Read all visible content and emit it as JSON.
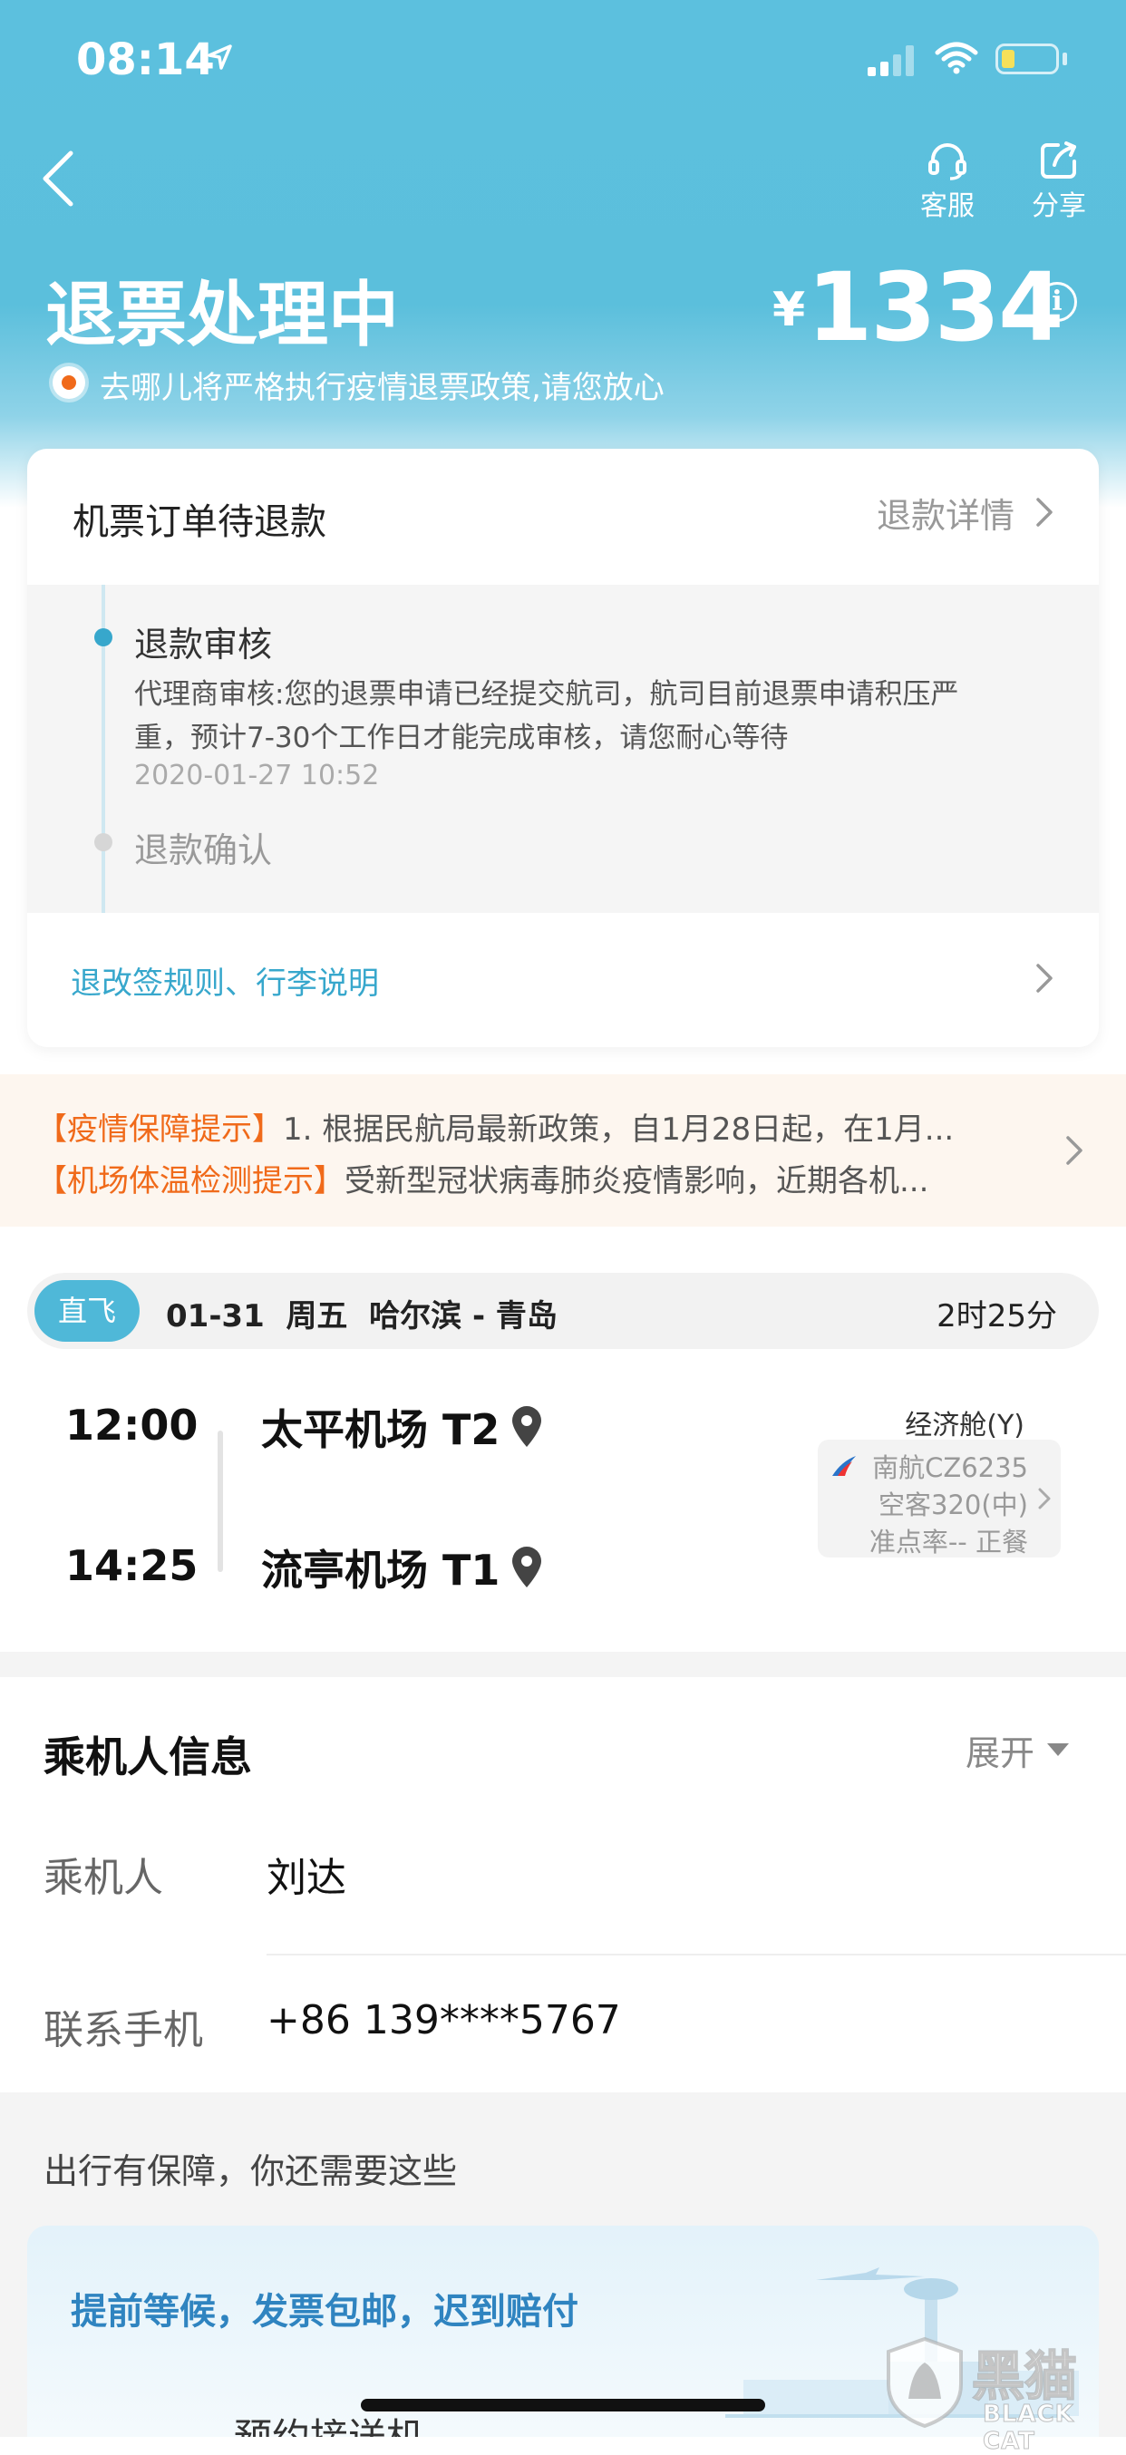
{
  "status_bar": {
    "time": "08:14"
  },
  "header": {
    "title": "退票处理中",
    "price_symbol": "¥",
    "price": "1334",
    "notice": "去哪儿将严格执行疫情退票政策,请您放心",
    "service_label": "客服",
    "share_label": "分享"
  },
  "refund_card": {
    "title": "机票订单待退款",
    "detail_link": "退款详情",
    "steps": [
      {
        "title": "退款审核",
        "desc_line1": "代理商审核:您的退票申请已经提交航司，航司目前退票申请积压严",
        "desc_line2": "重，预计7-30个工作日才能完成审核，请您耐心等待",
        "time": "2020-01-27 10:52"
      },
      {
        "title": "退款确认"
      }
    ],
    "rules_link": "退改签规则、行李说明"
  },
  "notices": {
    "line1_tag": "【疫情保障提示】",
    "line1_text": "1. 根据民航局最新政策，自1月28日起，在1月...",
    "line2_tag": "【机场体温检测提示】",
    "line2_text": "受新型冠状病毒肺炎疫情影响，近期各机..."
  },
  "flight": {
    "badge": "直飞",
    "date": "01-31",
    "weekday": "周五",
    "route": "哈尔滨 - 青岛",
    "duration": "2时25分",
    "depart_time": "12:00",
    "depart_airport": "太平机场 T2",
    "arrive_time": "14:25",
    "arrive_airport": "流亭机场 T1",
    "cabin": "经济舱(Y)",
    "airline_flight": "南航CZ6235",
    "aircraft": "空客320(中)",
    "punctuality_meal": "准点率-- 正餐"
  },
  "passenger": {
    "section_title": "乘机人信息",
    "expand_label": "展开",
    "name_label": "乘机人",
    "name": "刘达",
    "phone_label": "联系手机",
    "phone": "+86 139****5767"
  },
  "extras": {
    "section_title": "出行有保障，你还需要这些",
    "banner_text": "提前等候，发票包邮，迟到赔付",
    "next_item": "预约接送机"
  },
  "watermark": {
    "brand_cn": "黑猫",
    "brand_en": "BLACK CAT"
  },
  "colors": {
    "header": "#5bbfdc",
    "accent_blue": "#37a7cc",
    "orange": "#f06a1a"
  }
}
